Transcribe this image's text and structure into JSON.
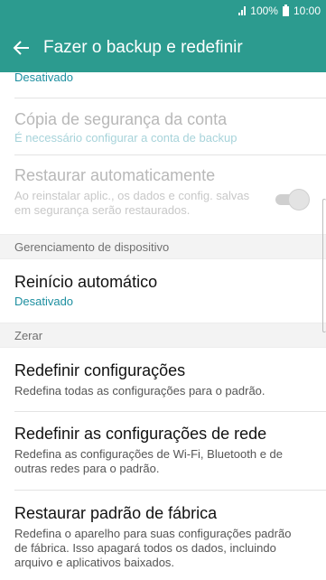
{
  "status_bar": {
    "battery": "100%",
    "time": "10:00"
  },
  "header": {
    "title": "Fazer o backup e redefinir",
    "back_icon": "arrow-left-icon"
  },
  "items": {
    "partial_value": "Desativado",
    "account_backup": {
      "title": "Cópia de segurança da conta",
      "subtitle": "É necessário configurar a conta de backup"
    },
    "auto_restore": {
      "title": "Restaurar automaticamente",
      "subtitle": "Ao reinstalar aplic., os dados e config. salvas em segurança serão restaurados.",
      "enabled": true,
      "disabled": true
    }
  },
  "sections": {
    "device_management": "Gerenciamento de dispositivo",
    "reset": "Zerar"
  },
  "device_items": {
    "auto_restart": {
      "title": "Reinício automático",
      "value": "Desativado"
    }
  },
  "reset_items": {
    "reset_settings": {
      "title": "Redefinir configurações",
      "subtitle": "Redefina todas as configurações para o padrão."
    },
    "reset_network": {
      "title": "Redefinir as configurações de rede",
      "subtitle": "Redefina as configurações de Wi-Fi, Bluetooth e de outras redes para o padrão."
    },
    "factory_reset": {
      "title": "Restaurar padrão de fábrica",
      "subtitle": "Redefina o aparelho para suas configurações padrão de fábrica. Isso apagará todos os dados, incluindo arquivo e aplicativos baixados."
    }
  },
  "colors": {
    "header": "#2c9b8f",
    "accent": "#1d8fa0"
  }
}
